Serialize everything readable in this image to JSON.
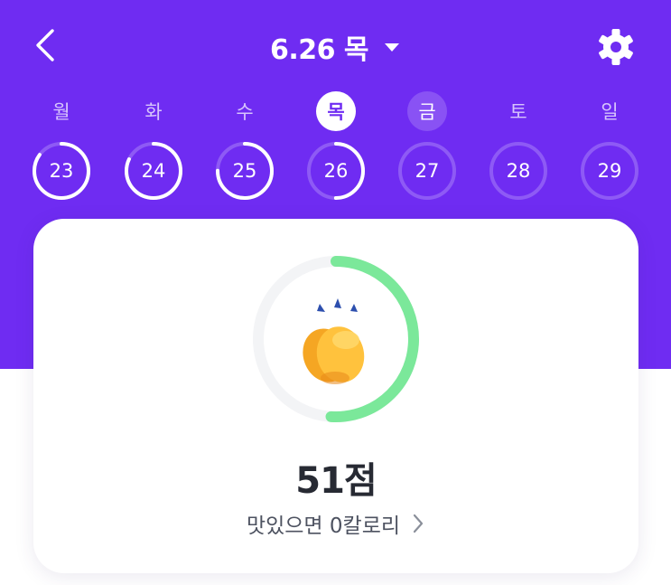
{
  "header": {
    "title": "6.26 목",
    "back_icon": "chevron-left-icon",
    "dropdown_icon": "caret-down-icon",
    "settings_icon": "gear-icon"
  },
  "week": {
    "days": [
      {
        "weekday": "월",
        "date": "23",
        "state": "past",
        "progress": 0.85
      },
      {
        "weekday": "화",
        "date": "24",
        "state": "past",
        "progress": 0.82
      },
      {
        "weekday": "수",
        "date": "25",
        "state": "past",
        "progress": 0.75
      },
      {
        "weekday": "목",
        "date": "26",
        "state": "today",
        "progress": 0.5
      },
      {
        "weekday": "금",
        "date": "27",
        "state": "selected",
        "progress": 0
      },
      {
        "weekday": "토",
        "date": "28",
        "state": "future",
        "progress": 0
      },
      {
        "weekday": "일",
        "date": "29",
        "state": "future",
        "progress": 0
      }
    ]
  },
  "score_card": {
    "score": 51,
    "score_text": "51점",
    "message": "맛있으면 0칼로리",
    "arrow_icon": "chevron-right-icon",
    "illustration": "clapping-hand-icon",
    "ring_color": "#7be89a",
    "track_color": "#f3f4f6"
  },
  "colors": {
    "brand": "#6f2cf2",
    "text_dark": "#272a33",
    "text_muted": "#4d5260"
  }
}
